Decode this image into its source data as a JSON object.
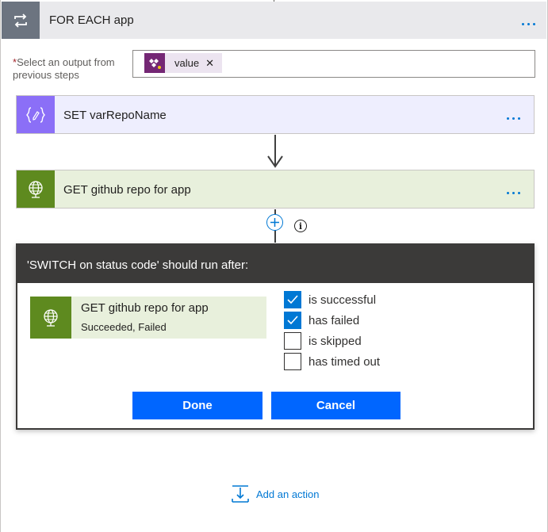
{
  "foreach": {
    "title": "FOR EACH app",
    "select_label": "Select an output from previous steps",
    "required_mark": "*",
    "token": {
      "label": "value",
      "remove": "✕"
    }
  },
  "actions": {
    "set_var": {
      "title": "SET varRepoName"
    },
    "get_repo": {
      "title": "GET github repo for app"
    }
  },
  "run_after_dialog": {
    "title": "'SWITCH on status code' should run after:",
    "source": {
      "title": "GET github repo for app",
      "status": "Succeeded, Failed"
    },
    "options": [
      {
        "label": "is successful",
        "checked": true
      },
      {
        "label": "has failed",
        "checked": true
      },
      {
        "label": "is skipped",
        "checked": false
      },
      {
        "label": "has timed out",
        "checked": false
      }
    ],
    "done_label": "Done",
    "cancel_label": "Cancel"
  },
  "add_action_label": "Add an action",
  "colors": {
    "accent": "#0078d4",
    "button": "#0066ff",
    "set_var_icon": "#8b6ff7",
    "github_icon": "#5e8a1f",
    "token_icon": "#742774"
  }
}
